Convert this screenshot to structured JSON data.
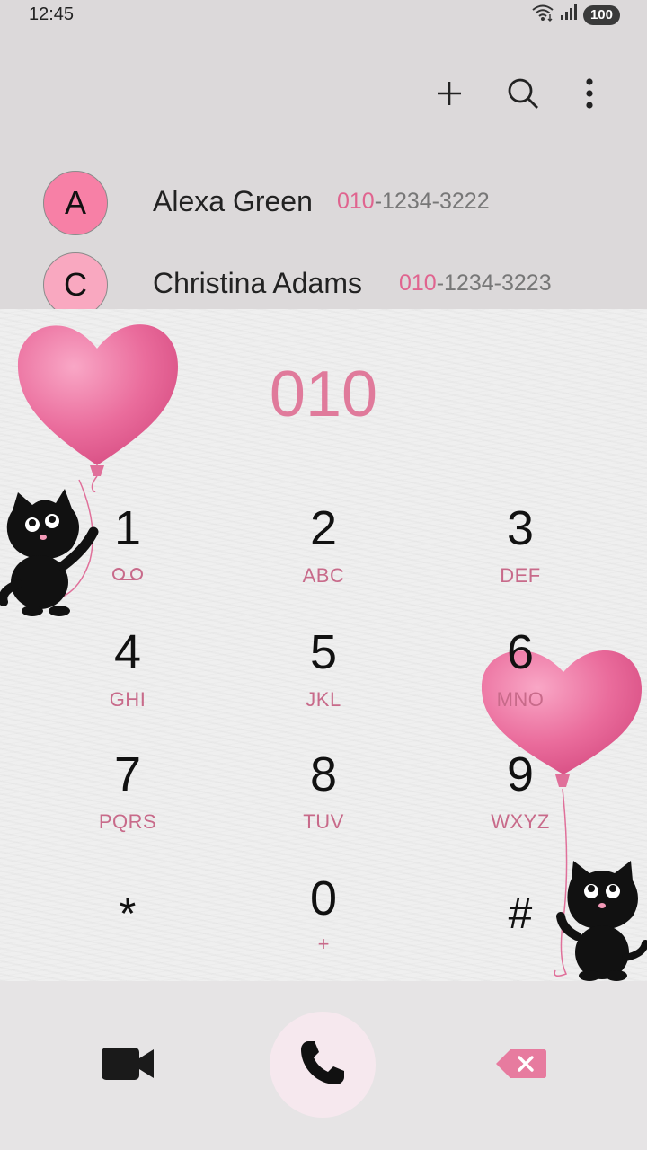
{
  "status": {
    "time": "12:45",
    "battery": "100",
    "icons": [
      "wifi-icon",
      "signal-icon"
    ]
  },
  "toolbar": {
    "add_icon": "plus-icon",
    "search_icon": "search-icon",
    "more_icon": "more-vert-icon"
  },
  "suggestions": [
    {
      "initial": "A",
      "name": "Alexa Green",
      "number_match": "010",
      "number_rest": "-1234-3222",
      "avatar_color": "#f780a6"
    },
    {
      "initial": "C",
      "name": "Christina Adams",
      "number_match": "010",
      "number_rest": "-1234-3223",
      "avatar_color": "#f9a8c0"
    }
  ],
  "dialer": {
    "entered": "010",
    "keys": [
      {
        "digit": "1",
        "letters": "",
        "icon": "voicemail-icon"
      },
      {
        "digit": "2",
        "letters": "ABC"
      },
      {
        "digit": "3",
        "letters": "DEF"
      },
      {
        "digit": "4",
        "letters": "GHI"
      },
      {
        "digit": "5",
        "letters": "JKL"
      },
      {
        "digit": "6",
        "letters": "MNO"
      },
      {
        "digit": "7",
        "letters": "PQRS"
      },
      {
        "digit": "8",
        "letters": "TUV"
      },
      {
        "digit": "9",
        "letters": "WXYZ"
      },
      {
        "digit": "*",
        "letters": ""
      },
      {
        "digit": "0",
        "letters": "+"
      },
      {
        "digit": "#",
        "letters": ""
      }
    ]
  },
  "actions": {
    "video_icon": "video-call-icon",
    "call_icon": "phone-icon",
    "delete_icon": "backspace-icon"
  },
  "colors": {
    "accent": "#e07a9b",
    "key_letters": "#c86a8a",
    "panel_top": "#dcd9da",
    "call_bg": "#f6e8ee"
  }
}
